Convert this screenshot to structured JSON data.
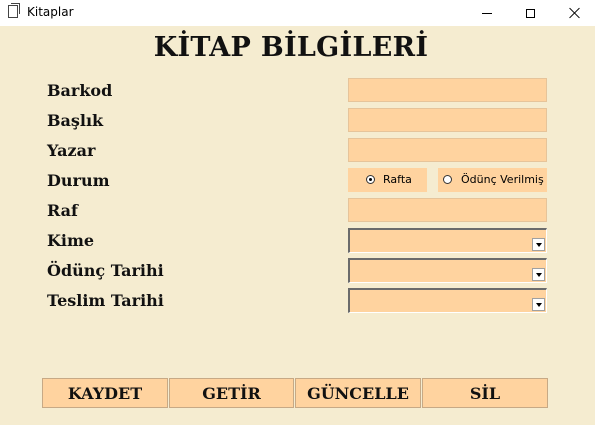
{
  "window": {
    "title": "Kitaplar"
  },
  "form": {
    "heading": "KİTAP BİLGİLERİ",
    "labels": {
      "barkod": "Barkod",
      "baslik": "Başlık",
      "yazar": "Yazar",
      "durum": "Durum",
      "raf": "Raf",
      "kime": "Kime",
      "odunc_tarihi": "Ödünç Tarihi",
      "teslim_tarihi": "Teslim Tarihi"
    },
    "values": {
      "barkod": "",
      "baslik": "",
      "yazar": "",
      "raf": "",
      "kime": "",
      "odunc_tarihi": "",
      "teslim_tarihi": ""
    },
    "durum_options": [
      {
        "label": "Rafta",
        "checked": true
      },
      {
        "label": "Ödünç Verilmiş",
        "checked": false
      }
    ]
  },
  "buttons": {
    "save": "KAYDET",
    "fetch": "GETİR",
    "update": "GÜNCELLE",
    "delete": "SİL"
  },
  "colors": {
    "form_background": "#f5ecd0",
    "field_background": "#ffd39f"
  }
}
